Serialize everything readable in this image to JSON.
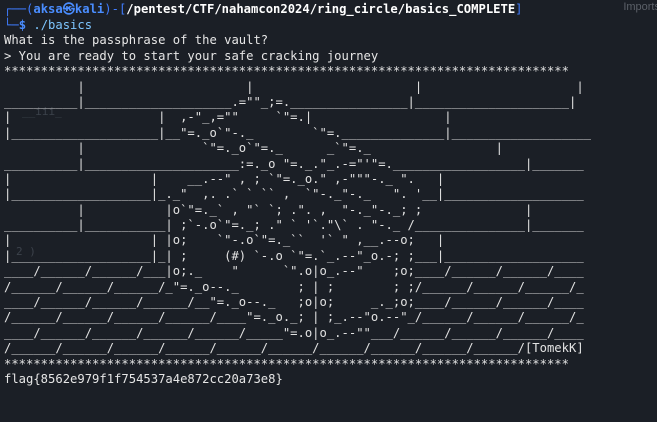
{
  "background_panel": {
    "label": "Imports"
  },
  "prompt": {
    "open": "┌──(",
    "user": "aksa",
    "at": "㉿",
    "host": "kali",
    "mid": ")-[",
    "cwd": "/pentest/CTF/nahamcon2024/ring_circle/basics_COMPLETE",
    "close": "]",
    "line2_prefix": "└─",
    "symbol": "$",
    "command": " ./basics"
  },
  "output": {
    "question": "What is the passphrase of the vault?",
    "status": "> You are ready to start your safe cracking journey",
    "stars": "*****************************************************************************",
    "art": [
      "          |                      |                      |                     |",
      "__________|____________________.=\"\"_;=.________________|_____________________|",
      "|                    |  ,-\"_,=\"\"     `\"=.|                  |",
      "|____________________|__\"=._o`\"-._        `\"=.______________|___________________",
      "          |                `\"=._o`\"=._      _`\"=._                 |",
      "__________|_____________________:=._o \"=._.\"_.-=\"'\"=.__________________|_______",
      "|                   |    __.--\" , ; `\"=._o.\" ,-\"\"\"-._ \".   |",
      "|___________________|_._\"  ,. .` ` `` ,  `\"-._\"-._   \". '__|___________________",
      "          |           |o`\"=._` , \"` `; .\". ,  \"-._\"-._; ;              |",
      "__________|___________| ;`-.o`\"=._; .\" ` '`.\"\\` . \"-._ /_______________|_______",
      "|                   | |o;    `\"-.o`\"=._``  '` \" ,__.--o;   |",
      "|___________________|_| ;     (#) `-.o `\"=.`_.--\"_o.-; ;___|___________________",
      "____/______/______/___|o;._    \"      `\".o|o_.--\"    ;o;____/______/______/____",
      "/______/______/______/_\"=._o--._        ; | ;        ; ;/______/______/______/_",
      "____/______/______/______/__\"=._o--._   ;o|o;     _._;o;____/______/______/____",
      "/______/______/______/______/____\"=._o._; | ;_.--\"o.--\"_/______/______/______/_",
      "____/______/______/______/______/_____\"=.o|o_.--\"\"___/______/______/______/____",
      "/______/______/______/______/______/______/______/______/______/______/[TomekK]"
    ],
    "flag": "flag{8562e979f1f754537a4e872cc20a73e8}"
  },
  "watermarks": {
    "w1": "__iii_",
    "w2": "2 )"
  },
  "colors": {
    "background": "#1b1f26",
    "prompt_frame": "#3f7cff",
    "text": "#e6e6e6"
  }
}
